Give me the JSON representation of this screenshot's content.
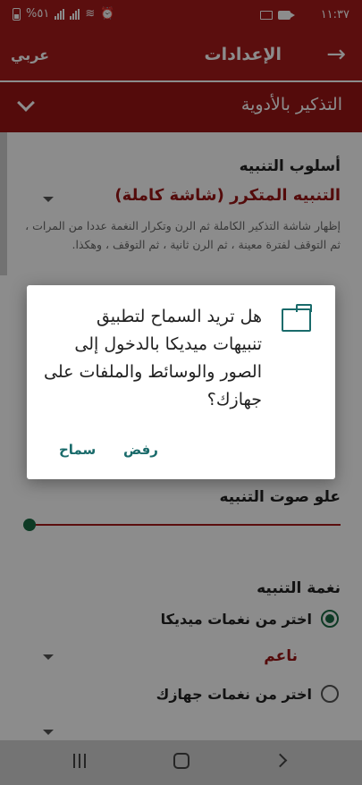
{
  "status_bar": {
    "time": "١١:٣٧",
    "battery": "%٥١"
  },
  "app_bar": {
    "title": "الإعدادات",
    "language_button": "عربي"
  },
  "section": {
    "title": "التذكير بالأدوية"
  },
  "settings": {
    "alert_style_label": "أسلوب التنبيه",
    "alert_style_value": "التنبيه المتكرر (شاشة كاملة)",
    "alert_style_description": "إظهار شاشة التذكير الكاملة ثم الرن وتكرار النغمة عددا من المرات ، ثم التوقف لفترة معينة ، ثم الرن ثانية ، ثم التوقف ، وهكذا.",
    "volume_label": "علو صوت التنبيه",
    "volume_level": 0,
    "tone_label": "نغمة التنبيه",
    "tone_option_media": "اختر من نغمات ميديكا",
    "tone_media_value": "ناعم",
    "tone_option_device": "اختر من نغمات جهازك"
  },
  "dialog": {
    "message": "هل تريد السماح لتطبيق تنبيهات ميديكا بالدخول إلى الصور والوسائط والملفات على جهازك؟",
    "deny_label": "رفض",
    "allow_label": "سماح"
  },
  "colors": {
    "primary": "#a61a1a",
    "accent": "#1a6b44",
    "dialog_button": "#1a6b6b"
  }
}
